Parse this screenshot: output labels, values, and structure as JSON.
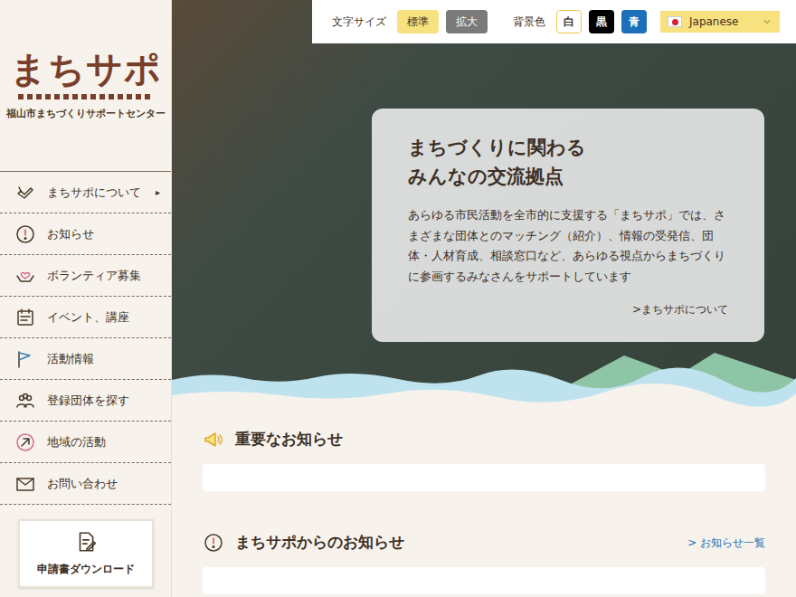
{
  "toolbar": {
    "font_size_label": "文字サイズ",
    "font_sizes": [
      {
        "label": "標準",
        "selected": true
      },
      {
        "label": "拡大",
        "selected": false
      }
    ],
    "bg_label": "背景色",
    "bg_options": [
      {
        "label": "白",
        "color": "#ffffff"
      },
      {
        "label": "黒",
        "color": "#000000"
      },
      {
        "label": "青",
        "color": "#1c6fb8"
      }
    ],
    "language": "Japanese"
  },
  "logo": {
    "title": "まちサポ",
    "subtitle": "福山市まちづくりサポートセンター"
  },
  "nav": [
    {
      "label": "まちサポについて",
      "arrow": "▸"
    },
    {
      "label": "お知らせ",
      "arrow": ""
    },
    {
      "label": "ボランティア募集",
      "arrow": ""
    },
    {
      "label": "イベント、講座",
      "arrow": ""
    },
    {
      "label": "活動情報",
      "arrow": ""
    },
    {
      "label": "登録団体を探す",
      "arrow": ""
    },
    {
      "label": "地域の活動",
      "arrow": ""
    },
    {
      "label": "お問い合わせ",
      "arrow": ""
    }
  ],
  "download_button": "申請書ダウンロード",
  "hero": {
    "title_lines": [
      "まちづくりに関わる",
      "みんなの交流拠点"
    ],
    "body": "あらゆる市民活動を全市的に支援する「まちサポ」では、さまざまな団体とのマッチング（紹介）、情報の受発信、団体・人材育成、相談窓口など、あらゆる視点からまちづくりに参画するみなさんをサポートしています",
    "link": ">まちサポについて"
  },
  "sections": [
    {
      "title": "重要なお知らせ",
      "link": ""
    },
    {
      "title": "まちサポからのお知らせ",
      "link": "> お知らせ一覧"
    }
  ]
}
